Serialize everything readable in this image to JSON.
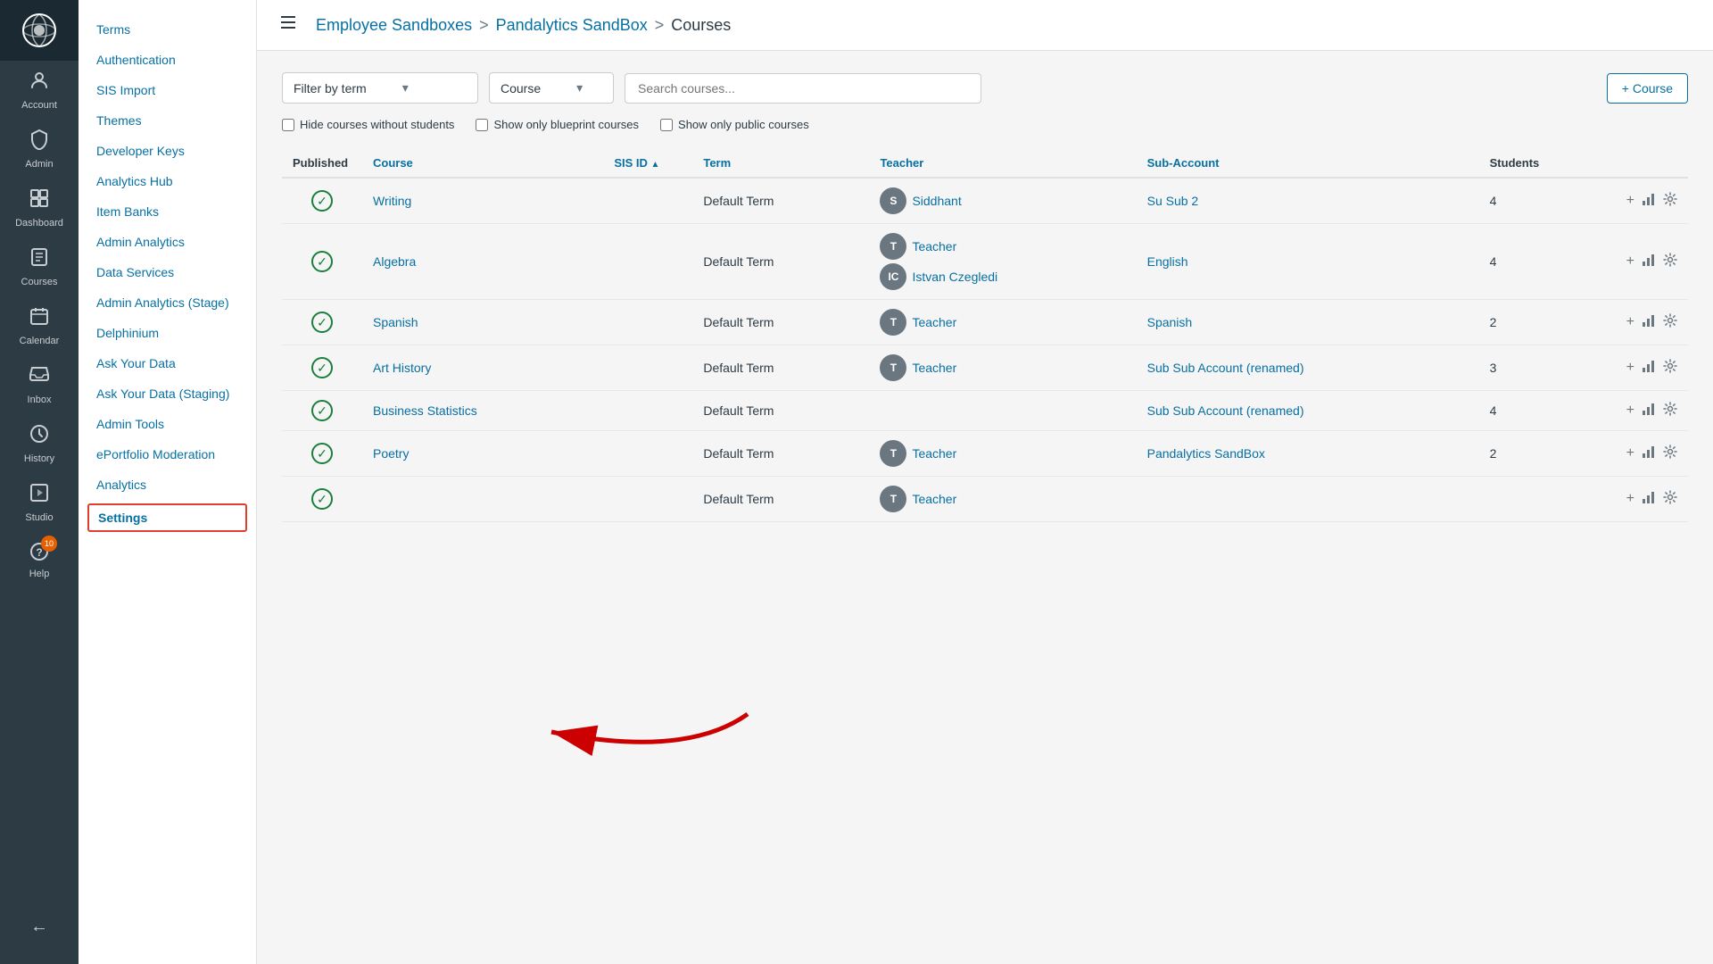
{
  "nav": {
    "items": [
      {
        "id": "account",
        "label": "Account",
        "icon": "👤"
      },
      {
        "id": "admin",
        "label": "Admin",
        "icon": "🛡"
      },
      {
        "id": "dashboard",
        "label": "Dashboard",
        "icon": "⊞"
      },
      {
        "id": "courses",
        "label": "Courses",
        "icon": "📋"
      },
      {
        "id": "calendar",
        "label": "Calendar",
        "icon": "📅"
      },
      {
        "id": "inbox",
        "label": "Inbox",
        "icon": "✉",
        "badge": null
      },
      {
        "id": "history",
        "label": "History",
        "icon": "🕐"
      },
      {
        "id": "studio",
        "label": "Studio",
        "icon": "⬛"
      },
      {
        "id": "help",
        "label": "Help",
        "icon": "❓",
        "badge": "10"
      }
    ],
    "back_label": "←"
  },
  "sidebar": {
    "items": [
      {
        "id": "terms",
        "label": "Terms"
      },
      {
        "id": "authentication",
        "label": "Authentication"
      },
      {
        "id": "sis-import",
        "label": "SIS Import"
      },
      {
        "id": "themes",
        "label": "Themes"
      },
      {
        "id": "developer-keys",
        "label": "Developer Keys"
      },
      {
        "id": "analytics-hub",
        "label": "Analytics Hub"
      },
      {
        "id": "item-banks",
        "label": "Item Banks"
      },
      {
        "id": "admin-analytics",
        "label": "Admin Analytics"
      },
      {
        "id": "data-services",
        "label": "Data Services"
      },
      {
        "id": "admin-analytics-stage",
        "label": "Admin Analytics (Stage)"
      },
      {
        "id": "delphinium",
        "label": "Delphinium"
      },
      {
        "id": "ask-your-data",
        "label": "Ask Your Data"
      },
      {
        "id": "ask-your-data-staging",
        "label": "Ask Your Data (Staging)"
      },
      {
        "id": "admin-tools",
        "label": "Admin Tools"
      },
      {
        "id": "eportfolio-moderation",
        "label": "ePortfolio Moderation"
      },
      {
        "id": "analytics",
        "label": "Analytics"
      },
      {
        "id": "settings",
        "label": "Settings"
      }
    ]
  },
  "header": {
    "breadcrumb": [
      {
        "label": "Employee Sandboxes",
        "link": true
      },
      {
        "label": "Pandalytics SandBox",
        "link": true
      },
      {
        "label": "Courses",
        "link": false
      }
    ]
  },
  "filters": {
    "term_placeholder": "Filter by term",
    "course_placeholder": "Course",
    "search_placeholder": "Search courses...",
    "add_course_label": "+ Course",
    "hide_label": "Hide courses without students",
    "blueprint_label": "Show only blueprint courses",
    "public_label": "Show only public courses"
  },
  "table": {
    "columns": [
      {
        "id": "published",
        "label": "Published"
      },
      {
        "id": "course",
        "label": "Course"
      },
      {
        "id": "sis_id",
        "label": "SIS ID",
        "sorted": true
      },
      {
        "id": "term",
        "label": "Term"
      },
      {
        "id": "teacher",
        "label": "Teacher"
      },
      {
        "id": "sub_account",
        "label": "Sub-Account"
      },
      {
        "id": "students",
        "label": "Students"
      }
    ],
    "rows": [
      {
        "published": true,
        "course": "Writing",
        "sis_id": "",
        "term": "Default Term",
        "teachers": [
          {
            "initials": "S",
            "name": "Siddhant"
          }
        ],
        "sub_account": "Su Sub 2",
        "students": 4
      },
      {
        "published": true,
        "course": "Algebra",
        "sis_id": "",
        "term": "Default Term",
        "teachers": [
          {
            "initials": "T",
            "name": "Teacher"
          },
          {
            "initials": "IC",
            "name": "Istvan Czegledi"
          }
        ],
        "sub_account": "English",
        "students": 4
      },
      {
        "published": true,
        "course": "Spanish",
        "sis_id": "",
        "term": "Default Term",
        "teachers": [
          {
            "initials": "T",
            "name": "Teacher"
          }
        ],
        "sub_account": "Spanish",
        "students": 2
      },
      {
        "published": true,
        "course": "Art History",
        "sis_id": "",
        "term": "Default Term",
        "teachers": [
          {
            "initials": "T",
            "name": "Teacher"
          }
        ],
        "sub_account": "Sub Sub Account (renamed)",
        "students": 3
      },
      {
        "published": true,
        "course": "Business Statistics",
        "sis_id": "",
        "term": "Default Term",
        "teachers": [],
        "sub_account": "Sub Sub Account (renamed)",
        "students": 4
      },
      {
        "published": true,
        "course": "Poetry",
        "sis_id": "",
        "term": "Default Term",
        "teachers": [
          {
            "initials": "T",
            "name": "Teacher"
          }
        ],
        "sub_account": "Pandalytics SandBox",
        "students": 2
      },
      {
        "published": true,
        "course": "",
        "sis_id": "",
        "term": "Default Term",
        "teachers": [
          {
            "initials": "T",
            "name": "Teacher"
          }
        ],
        "sub_account": "",
        "students": null
      }
    ]
  }
}
